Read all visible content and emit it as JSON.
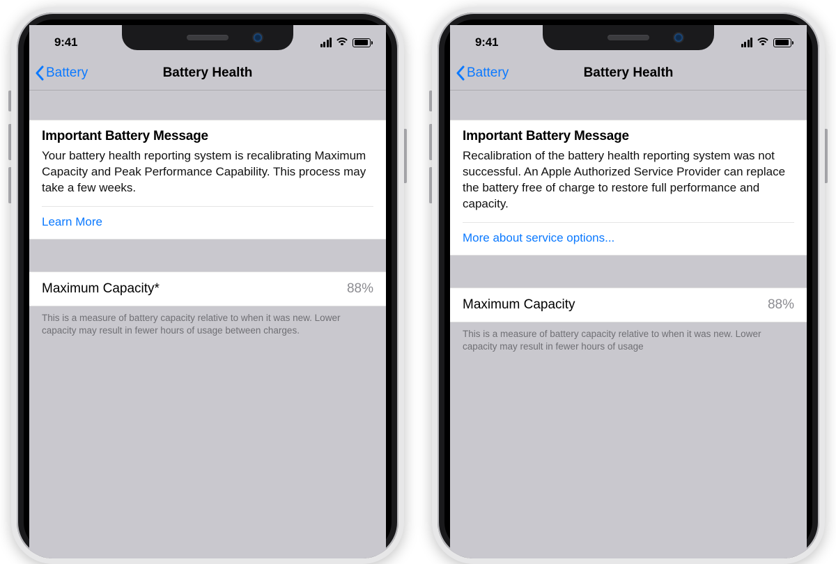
{
  "status": {
    "time": "9:41"
  },
  "nav": {
    "back_label": "Battery",
    "title": "Battery Health"
  },
  "left": {
    "message_title": "Important Battery Message",
    "message_body": "Your battery health reporting system is recalibrating Maximum Capacity and Peak Performance Capability. This process may take a few weeks.",
    "link_label": "Learn More",
    "capacity_label": "Maximum Capacity*",
    "capacity_value": "88%",
    "capacity_footer": "This is a measure of battery capacity relative to when it was new. Lower capacity may result in fewer hours of usage between charges."
  },
  "right": {
    "message_title": "Important Battery Message",
    "message_body": "Recalibration of the battery health reporting system was not successful. An Apple Authorized Service Provider can replace the battery free of charge to restore full performance and capacity.",
    "link_label": "More about service options...",
    "capacity_label": "Maximum Capacity",
    "capacity_value": "88%",
    "capacity_footer": "This is a measure of battery capacity relative to when it was new. Lower capacity may result in fewer hours of usage"
  }
}
